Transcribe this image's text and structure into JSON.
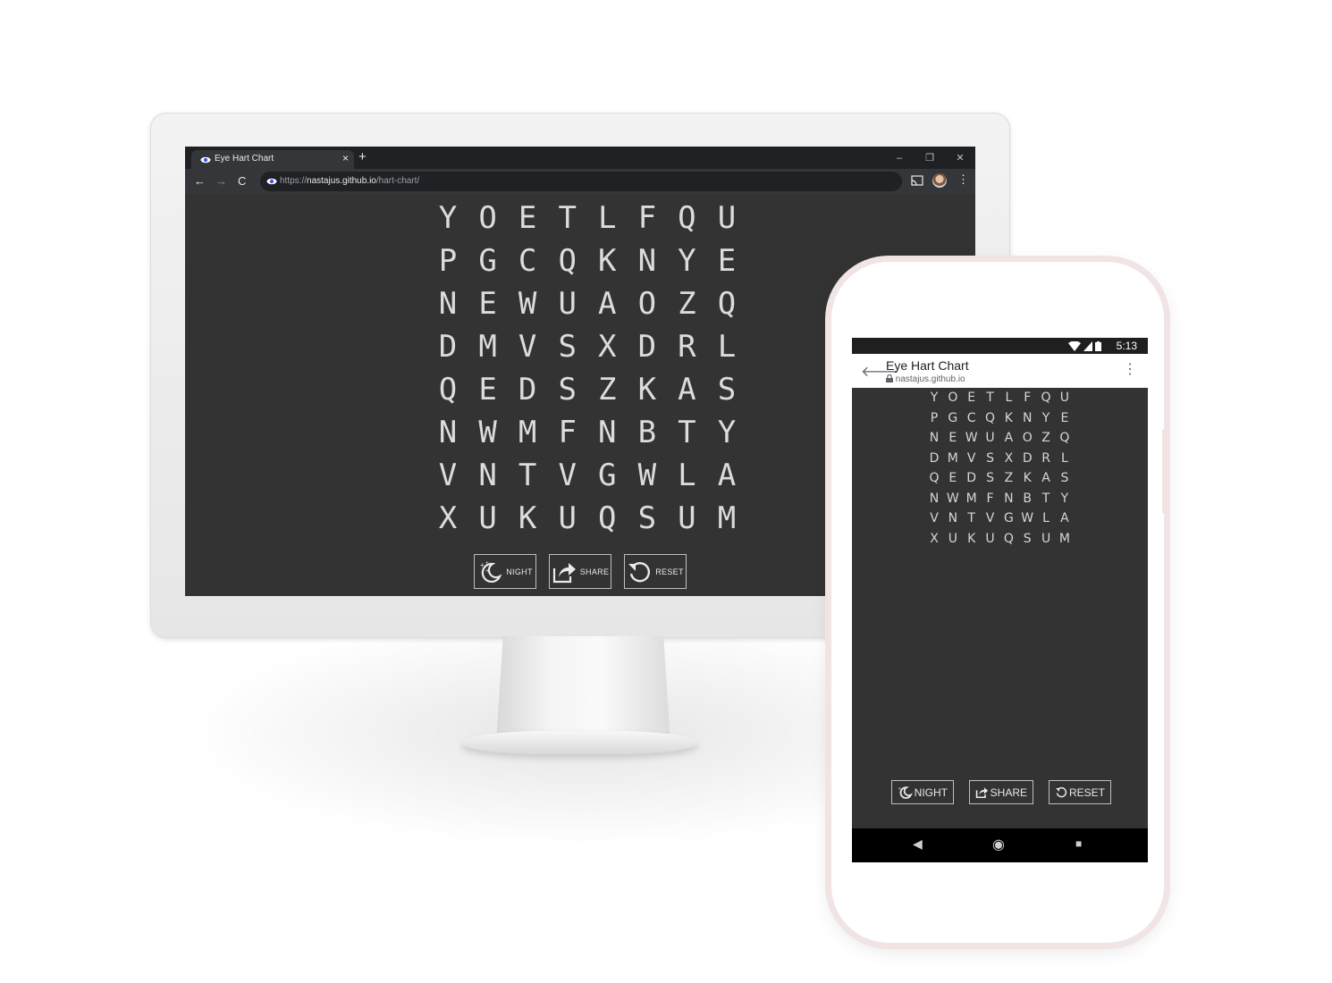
{
  "desktop": {
    "tab_title": "Eye Hart Chart",
    "tab_close": "×",
    "new_tab": "+",
    "window_controls": {
      "minimize": "–",
      "restore": "❐",
      "close": "✕"
    },
    "nav": {
      "back": "←",
      "forward": "→",
      "reload": "C"
    },
    "url_scheme": "https://",
    "url_host": "nastajus.github.io",
    "url_path": "/hart-chart/",
    "menu_icon": "⋮",
    "rows": [
      [
        "Y",
        "O",
        "E",
        "T",
        "L",
        "F",
        "Q",
        "U"
      ],
      [
        "P",
        "G",
        "C",
        "Q",
        "K",
        "N",
        "Y",
        "E"
      ],
      [
        "N",
        "E",
        "W",
        "U",
        "A",
        "O",
        "Z",
        "Q"
      ],
      [
        "D",
        "M",
        "V",
        "S",
        "X",
        "D",
        "R",
        "L"
      ],
      [
        "Q",
        "E",
        "D",
        "S",
        "Z",
        "K",
        "A",
        "S"
      ],
      [
        "N",
        "W",
        "M",
        "F",
        "N",
        "B",
        "T",
        "Y"
      ],
      [
        "V",
        "N",
        "T",
        "V",
        "G",
        "W",
        "L",
        "A"
      ],
      [
        "X",
        "U",
        "K",
        "U",
        "Q",
        "S",
        "U",
        "M"
      ]
    ],
    "buttons": {
      "night": "NIGHT",
      "share": "SHARE",
      "reset": "RESET"
    }
  },
  "phone": {
    "time": "5:13",
    "title": "Eye Hart Chart",
    "url": "nastajus.github.io",
    "back_icon": "🡐",
    "menu_icon": "⋮",
    "rows": [
      [
        "Y",
        "O",
        "E",
        "T",
        "L",
        "F",
        "Q",
        "U"
      ],
      [
        "P",
        "G",
        "C",
        "Q",
        "K",
        "N",
        "Y",
        "E"
      ],
      [
        "N",
        "E",
        "W",
        "U",
        "A",
        "O",
        "Z",
        "Q"
      ],
      [
        "D",
        "M",
        "V",
        "S",
        "X",
        "D",
        "R",
        "L"
      ],
      [
        "Q",
        "E",
        "D",
        "S",
        "Z",
        "K",
        "A",
        "S"
      ],
      [
        "N",
        "W",
        "M",
        "F",
        "N",
        "B",
        "T",
        "Y"
      ],
      [
        "V",
        "N",
        "T",
        "V",
        "G",
        "W",
        "L",
        "A"
      ],
      [
        "X",
        "U",
        "K",
        "U",
        "Q",
        "S",
        "U",
        "M"
      ]
    ],
    "buttons": {
      "night": "NIGHT",
      "share": "SHARE",
      "reset": "RESET"
    },
    "navbar": {
      "back": "◀",
      "home": "◉",
      "recents": "■"
    }
  },
  "colors": {
    "page_bg": "#333333",
    "letter": "#dcdcdc",
    "chrome_dark": "#202124"
  }
}
